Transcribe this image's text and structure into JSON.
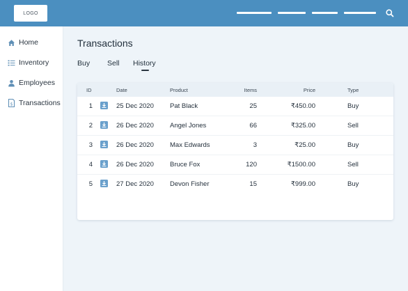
{
  "header": {
    "logo_text": "LOGO",
    "nav_links": [
      "",
      "",
      "",
      ""
    ],
    "search_icon": "search-icon",
    "bar_color": "#4b8fc0"
  },
  "sidebar": {
    "items": [
      {
        "label": "Home",
        "icon": "home-icon"
      },
      {
        "label": "Inventory",
        "icon": "list-icon"
      },
      {
        "label": "Employees",
        "icon": "user-icon"
      },
      {
        "label": "Transactions",
        "icon": "receipt-icon"
      }
    ]
  },
  "main": {
    "title": "Transactions",
    "tabs": [
      {
        "label": "Buy"
      },
      {
        "label": "Sell"
      },
      {
        "label": "History",
        "active": true
      }
    ],
    "table": {
      "columns": [
        "ID",
        "Date",
        "Product",
        "Items",
        "Price",
        "Type"
      ],
      "row_icon": "download-icon",
      "rows": [
        {
          "id": "1",
          "date": "25 Dec 2020",
          "product": "Pat Black",
          "items": "25",
          "price": "₹450.00",
          "type": "Buy"
        },
        {
          "id": "2",
          "date": "26 Dec 2020",
          "product": "Angel Jones",
          "items": "66",
          "price": "₹325.00",
          "type": "Sell"
        },
        {
          "id": "3",
          "date": "26 Dec 2020",
          "product": "Max Edwards",
          "items": "3",
          "price": "₹25.00",
          "type": "Buy"
        },
        {
          "id": "4",
          "date": "26 Dec 2020",
          "product": "Bruce Fox",
          "items": "120",
          "price": "₹1500.00",
          "type": "Sell"
        },
        {
          "id": "5",
          "date": "27 Dec 2020",
          "product": "Devon Fisher",
          "items": "15",
          "price": "₹999.00",
          "type": "Buy"
        }
      ]
    }
  }
}
